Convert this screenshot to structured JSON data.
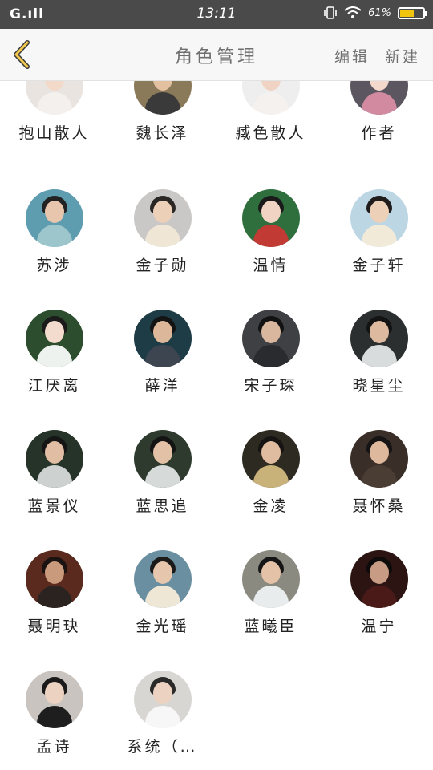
{
  "status_bar": {
    "signal": "G.ıll",
    "time": "13:11",
    "battery": "61%",
    "battery_level": 0.61,
    "battery_color": "#f1c40f"
  },
  "header": {
    "title": "角色管理",
    "edit_label": "编辑",
    "new_label": "新建"
  },
  "characters": [
    {
      "name": "抱山散人",
      "bg": "#e9e4e0",
      "skin": "#f3d9c8",
      "hair": "#d9c9be",
      "cloth": "#f4f0ee"
    },
    {
      "name": "魏长泽",
      "bg": "#8a7a5a",
      "skin": "#e2c0a0",
      "hair": "#2a2420",
      "cloth": "#3a3a3a"
    },
    {
      "name": "臧色散人",
      "bg": "#efeeee",
      "skin": "#f0d3c2",
      "hair": "#1e1a18",
      "cloth": "#f5f1ef"
    },
    {
      "name": "作者",
      "bg": "#5b5660",
      "skin": "#f3d8cc",
      "hair": "#1d1b1e",
      "cloth": "#d28aa0"
    },
    {
      "name": "苏涉",
      "bg": "#5e9cb0",
      "skin": "#e8c6ad",
      "hair": "#222",
      "cloth": "#9cc6cc"
    },
    {
      "name": "金子勋",
      "bg": "#c9c8c6",
      "skin": "#ecd0b8",
      "hair": "#2b2724",
      "cloth": "#efe6d6"
    },
    {
      "name": "温情",
      "bg": "#2f6f3e",
      "skin": "#f0d3c3",
      "hair": "#1a1a1a",
      "cloth": "#c23a34"
    },
    {
      "name": "金子轩",
      "bg": "#bcd6e4",
      "skin": "#ecd0b8",
      "hair": "#1f1c1b",
      "cloth": "#f2ead8"
    },
    {
      "name": "江厌离",
      "bg": "#2c4d2e",
      "skin": "#f3dbcd",
      "hair": "#1b1b1b",
      "cloth": "#eef2ee"
    },
    {
      "name": "薛洋",
      "bg": "#1d3c45",
      "skin": "#dcb79a",
      "hair": "#141414",
      "cloth": "#3d4550"
    },
    {
      "name": "宋子琛",
      "bg": "#3f4044",
      "skin": "#d9b79e",
      "hair": "#121212",
      "cloth": "#2a2b2e"
    },
    {
      "name": "晓星尘",
      "bg": "#2c2f30",
      "skin": "#ddb99f",
      "hair": "#131313",
      "cloth": "#d9dcdc"
    },
    {
      "name": "蓝景仪",
      "bg": "#263329",
      "skin": "#e1bea3",
      "hair": "#151515",
      "cloth": "#cdd2d0"
    },
    {
      "name": "蓝思追",
      "bg": "#2e3a2e",
      "skin": "#e3c1a7",
      "hair": "#141414",
      "cloth": "#d6dbd9"
    },
    {
      "name": "金凌",
      "bg": "#2d2a22",
      "skin": "#dfbb9f",
      "hair": "#161412",
      "cloth": "#c9b27a"
    },
    {
      "name": "聂怀桑",
      "bg": "#3a2e28",
      "skin": "#ddb89c",
      "hair": "#151313",
      "cloth": "#4a3d33"
    },
    {
      "name": "聂明玦",
      "bg": "#5a2a1e",
      "skin": "#c99a7c",
      "hair": "#1a1312",
      "cloth": "#2a2320"
    },
    {
      "name": "金光瑶",
      "bg": "#6a8fa0",
      "skin": "#e6c6ad",
      "hair": "#1c1a18",
      "cloth": "#efe7d6"
    },
    {
      "name": "蓝曦臣",
      "bg": "#8a8a80",
      "skin": "#e3c2a8",
      "hair": "#151515",
      "cloth": "#e8ecec"
    },
    {
      "name": "温宁",
      "bg": "#2b1412",
      "skin": "#c79b84",
      "hair": "#0e0b0b",
      "cloth": "#4a1a18"
    },
    {
      "name": "孟诗",
      "bg": "#c9c4bf",
      "skin": "#ecd2c0",
      "hair": "#1a1a1a",
      "cloth": "#1e1e1e"
    },
    {
      "name": "系统（…",
      "bg": "#d8d6d3",
      "skin": "#ecd2c0",
      "hair": "#2a2a2a",
      "cloth": "#f7f7f7"
    }
  ]
}
